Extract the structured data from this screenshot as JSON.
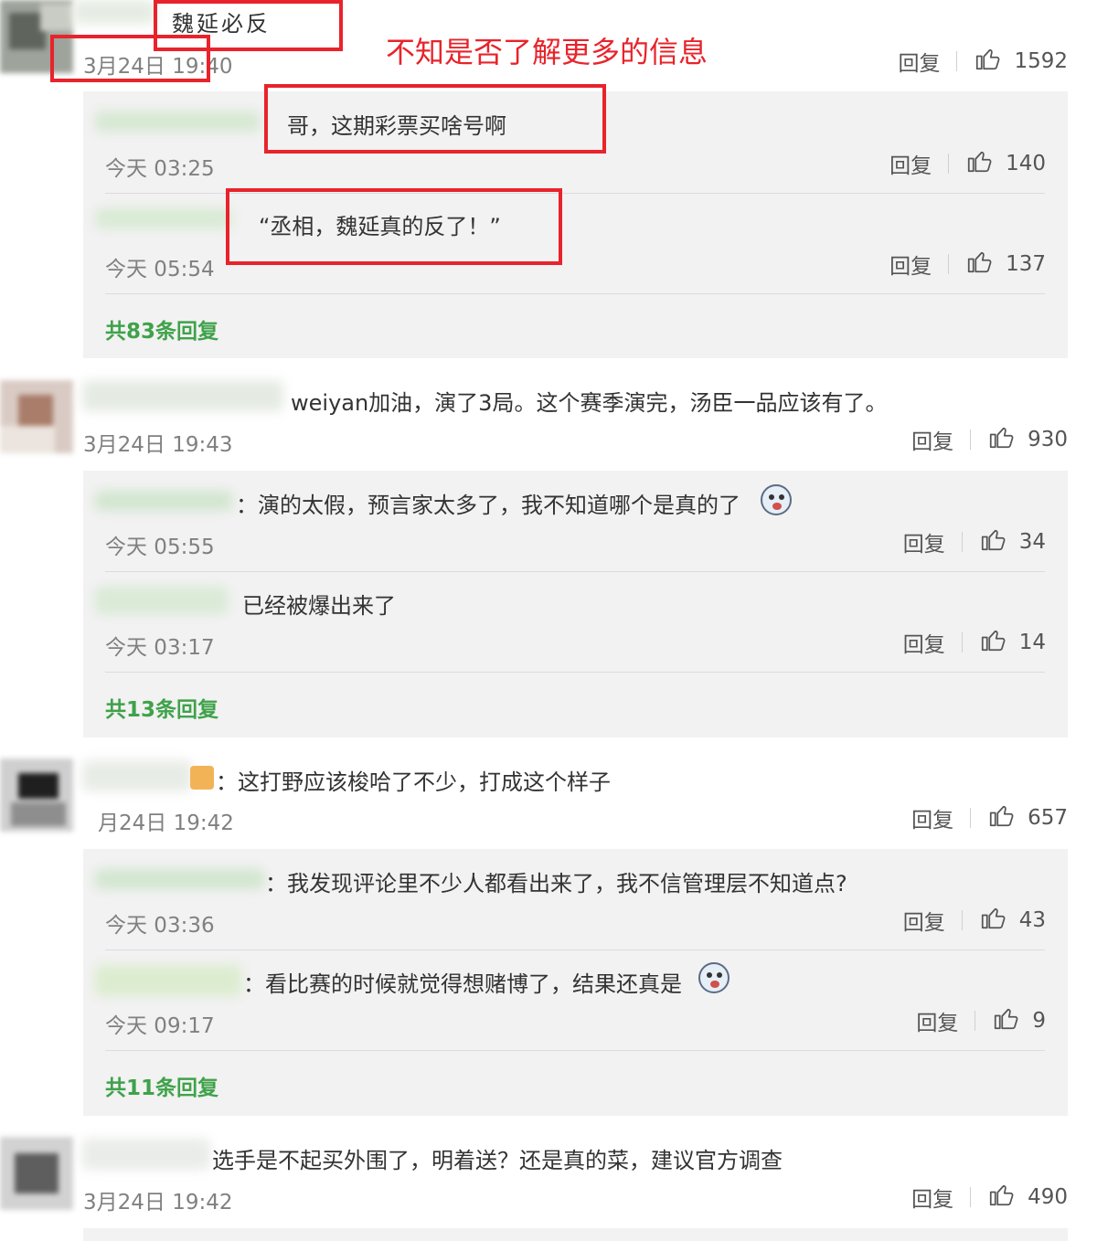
{
  "annotation": {
    "label": "不知是否了解更多的信息",
    "color": "#e8232b"
  },
  "ui": {
    "reply_label": "回复",
    "like_icon": "thumbs-up-icon",
    "link_color": "#3fa24a"
  },
  "comments": [
    {
      "name_visible": "魏延必反",
      "text": "",
      "time": "3月24日 19:40",
      "likes": "1592",
      "replies": [
        {
          "text": "哥，这期彩票买啥号啊",
          "time": "今天 03:25",
          "likes": "140"
        },
        {
          "text": "“丞相，魏延真的反了！”",
          "time": "今天 05:54",
          "likes": "137"
        }
      ],
      "more": "共83条回复"
    },
    {
      "text": "weiyan加油，演了3局。这个赛季演完，汤臣一品应该有了。",
      "time": "3月24日 19:43",
      "likes": "930",
      "replies": [
        {
          "text": "：演的太假，预言家太多了，我不知道哪个是真的了",
          "time": "今天 05:55",
          "likes": "34"
        },
        {
          "text": "已经被爆出来了",
          "time": "今天 03:17",
          "likes": "14"
        }
      ],
      "more": "共13条回复"
    },
    {
      "text": "：这打野应该梭哈了不少，打成这个样子",
      "time": "月24日 19:42",
      "likes": "657",
      "replies": [
        {
          "text": "：我发现评论里不少人都看出来了，我不信管理层不知道点?",
          "time": "今天 03:36",
          "likes": "43"
        },
        {
          "text": "：看比赛的时候就觉得想赌博了，结果还真是",
          "time": "今天 09:17",
          "likes": "9"
        }
      ],
      "more": "共11条回复"
    },
    {
      "text": "选手是不起买外围了，明着送？还是真的菜，建议官方调查",
      "time": "3月24日 19:42",
      "likes": "490"
    }
  ]
}
